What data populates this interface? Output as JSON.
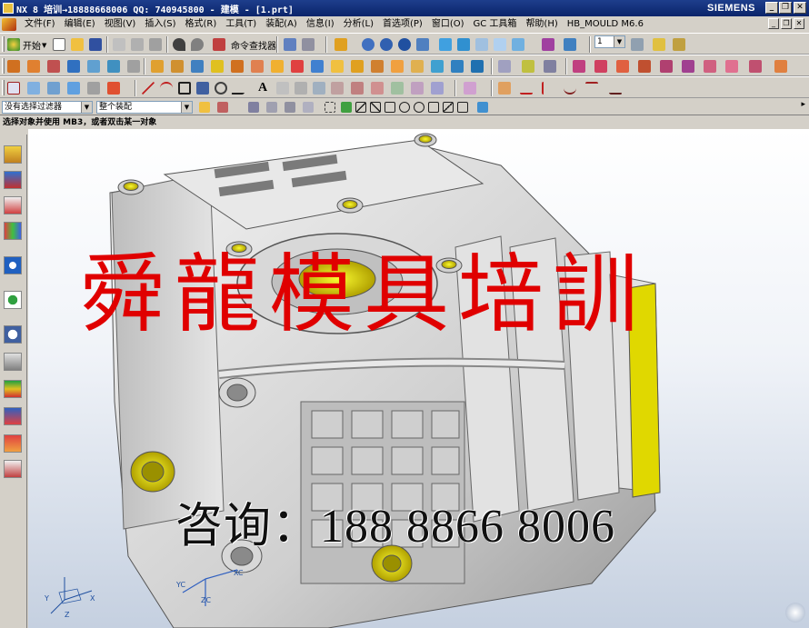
{
  "window": {
    "title": "NX 8 培训→18888668006 QQ: 740945800 - 建模 - [1.prt]",
    "brand": "SIEMENS",
    "controls": [
      "_",
      "❐",
      "✕"
    ]
  },
  "menubar": {
    "items": [
      "文件(F)",
      "编辑(E)",
      "视图(V)",
      "插入(S)",
      "格式(R)",
      "工具(T)",
      "装配(A)",
      "信息(I)",
      "分析(L)",
      "首选项(P)",
      "窗口(O)",
      "GC 工具箱",
      "帮助(H)",
      "HB_MOULD M6.6"
    ]
  },
  "toolbar1": {
    "start_label": "开始",
    "command_finder_label": "命令查找器",
    "layer_value": "1"
  },
  "selection_bar": {
    "filter_value": "没有选择过滤器",
    "scope_value": "整个装配"
  },
  "cue_line": {
    "text": "选择对象并使用 MB3，或者双击某一对象"
  },
  "overlay": {
    "watermark": "舜龍模具培訓",
    "consult": "咨询：188 8866 8006"
  },
  "triad": {
    "x": "X",
    "y": "Y",
    "z": "Z",
    "xc": "XC",
    "yc": "YC",
    "zc": "ZC"
  },
  "colors": {
    "titlebar": "#0a246a",
    "chrome": "#d4d0c8",
    "part_body": "#dcdcdc",
    "highlight_face": "#f2f212",
    "watermark": "#e00000"
  }
}
